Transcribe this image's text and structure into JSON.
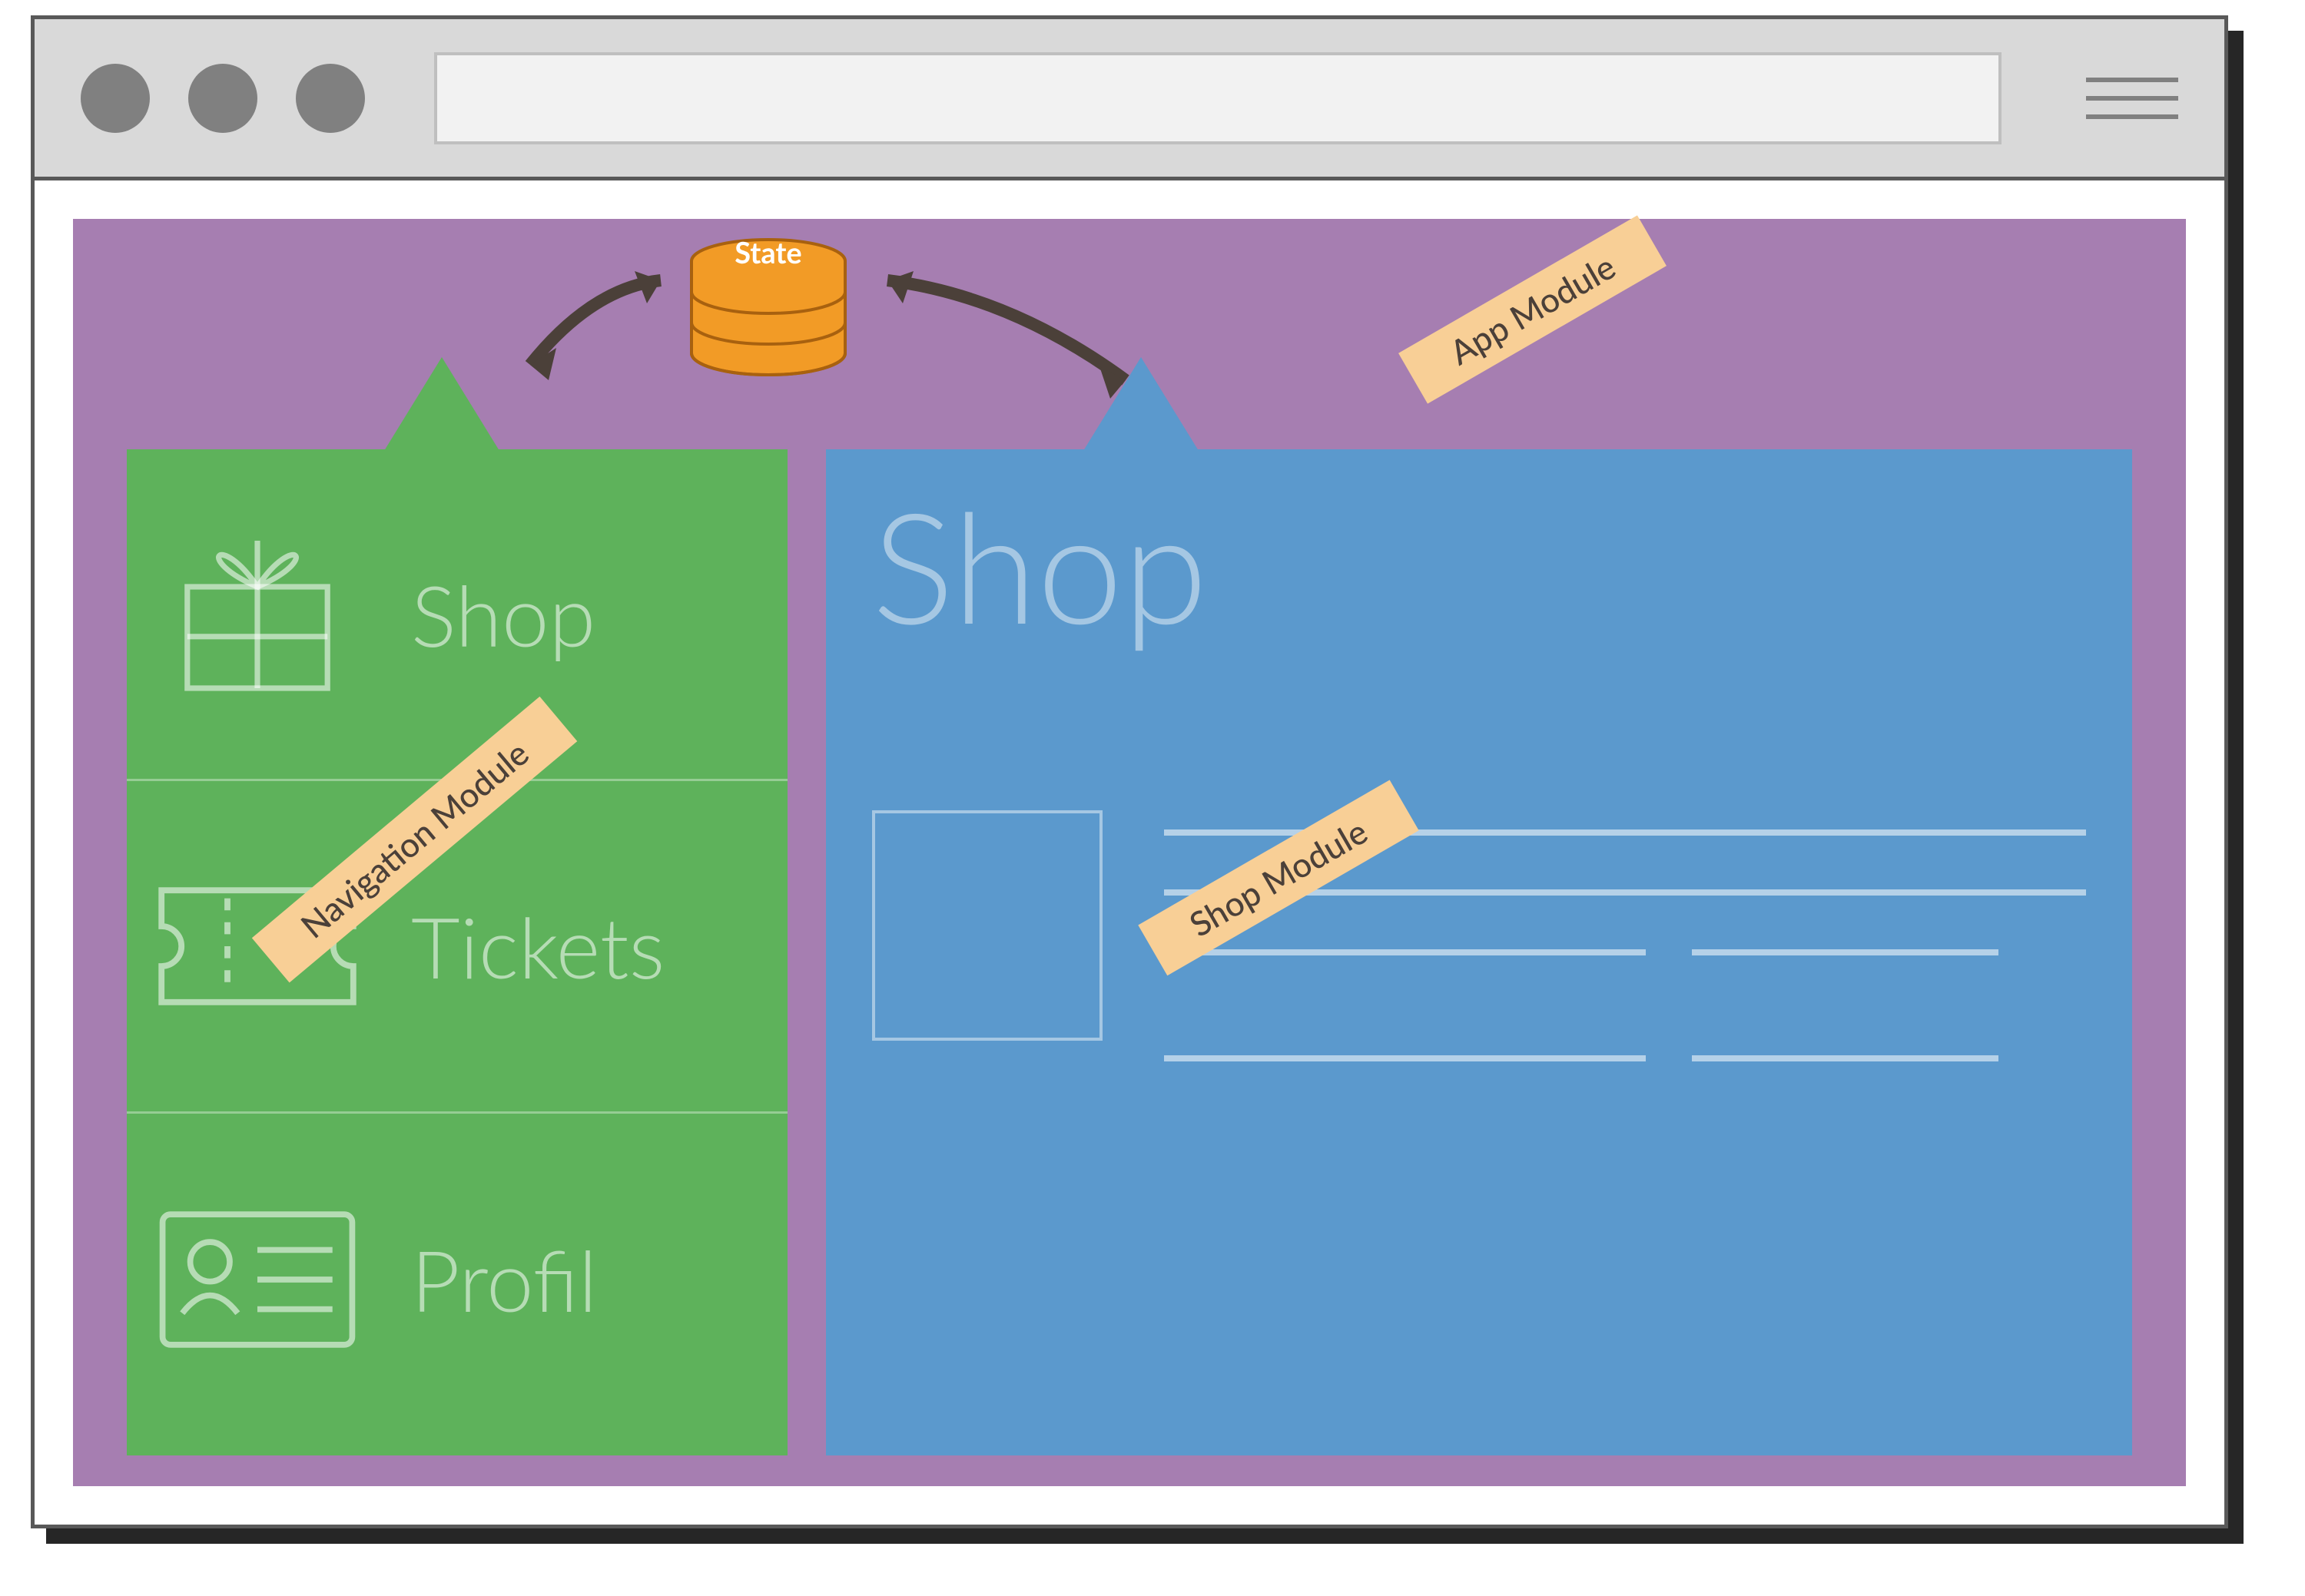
{
  "state": {
    "label": "State"
  },
  "modules": {
    "app": "App Module",
    "nav": "Navigation Module",
    "shop": "Shop Module"
  },
  "nav_items": [
    {
      "label": "Shop",
      "icon": "gift-icon"
    },
    {
      "label": "Tickets",
      "icon": "ticket-icon"
    },
    {
      "label": "Profil",
      "icon": "id-card-icon"
    }
  ],
  "shop_page": {
    "title": "Shop"
  },
  "colors": {
    "app_bg": "#A67EB1",
    "nav_bg": "#5EB25B",
    "shop_bg": "#5B99CD",
    "state": "#F29B26",
    "sticker": "#F8CF96"
  }
}
